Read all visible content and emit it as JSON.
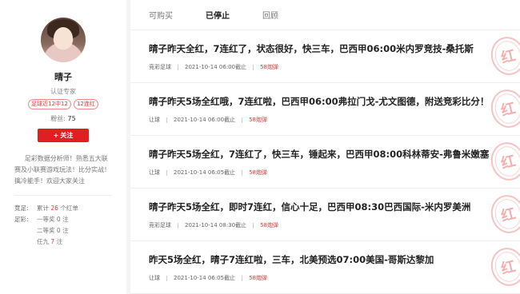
{
  "profile": {
    "name": "晴子",
    "role": "认证专家",
    "badges": [
      "足球近12中12",
      "12连红"
    ],
    "fans_label": "粉丝:",
    "fans_count": "75",
    "follow_label": "关注",
    "bio": "足彩数据分析师！熟悉五大联赛及小联赛游戏玩法！比分实战！擒冷能手！欢迎大家关注",
    "stats": [
      {
        "key": "竞足:",
        "prefix": "累计",
        "num": "26",
        "suffix": "个红单"
      },
      {
        "key": "足彩:",
        "prefix": "一等奖",
        "num": "0",
        "suffix": "注"
      },
      {
        "key": "",
        "prefix": "二等奖",
        "num": "0",
        "suffix": "注"
      },
      {
        "key": "",
        "prefix": "任九",
        "num": "7",
        "suffix": "注"
      }
    ]
  },
  "tabs": [
    {
      "label": "可购买",
      "active": false
    },
    {
      "label": "已停止",
      "active": true
    },
    {
      "label": "回顾",
      "active": false
    }
  ],
  "articles": [
    {
      "title": "晴子昨天全红，7连红了，状态很好，快三车，巴西甲06:00米内罗竞技-桑托斯",
      "category": "竞彩足球",
      "time": "2021-10-14 06:00截止",
      "bullets": "58炮弹",
      "stamp": "红"
    },
    {
      "title": "晴子昨天5场全红哦，7连红啦，巴西甲06:00弗拉门戈-尤文图德，附送竞彩比分！",
      "category": "让球",
      "time": "2021-10-14 06:00截止",
      "bullets": "58炮弹",
      "stamp": "红"
    },
    {
      "title": "晴子昨天5场全红，7连红了，快三车，锤起来，巴西甲08:00科林蒂安-弗鲁米嫩塞",
      "category": "让球",
      "time": "2021-10-14 06:05截止",
      "bullets": "58炮弹",
      "stamp": "红"
    },
    {
      "title": "晴子昨天5场全红，即时7连红，信心十足，巴西甲08:30巴西国际-米内罗美洲",
      "category": "竞彩足球",
      "time": "2021-10-14 08:30截止",
      "bullets": "58炮弹",
      "stamp": "红"
    },
    {
      "title": "昨天5场全红，晴子7连红啦，三车，北美预选07:00美国-哥斯达黎加",
      "category": "让球",
      "time": "2021-10-14 06:05截止",
      "bullets": "58炮弹",
      "stamp": "红"
    }
  ]
}
